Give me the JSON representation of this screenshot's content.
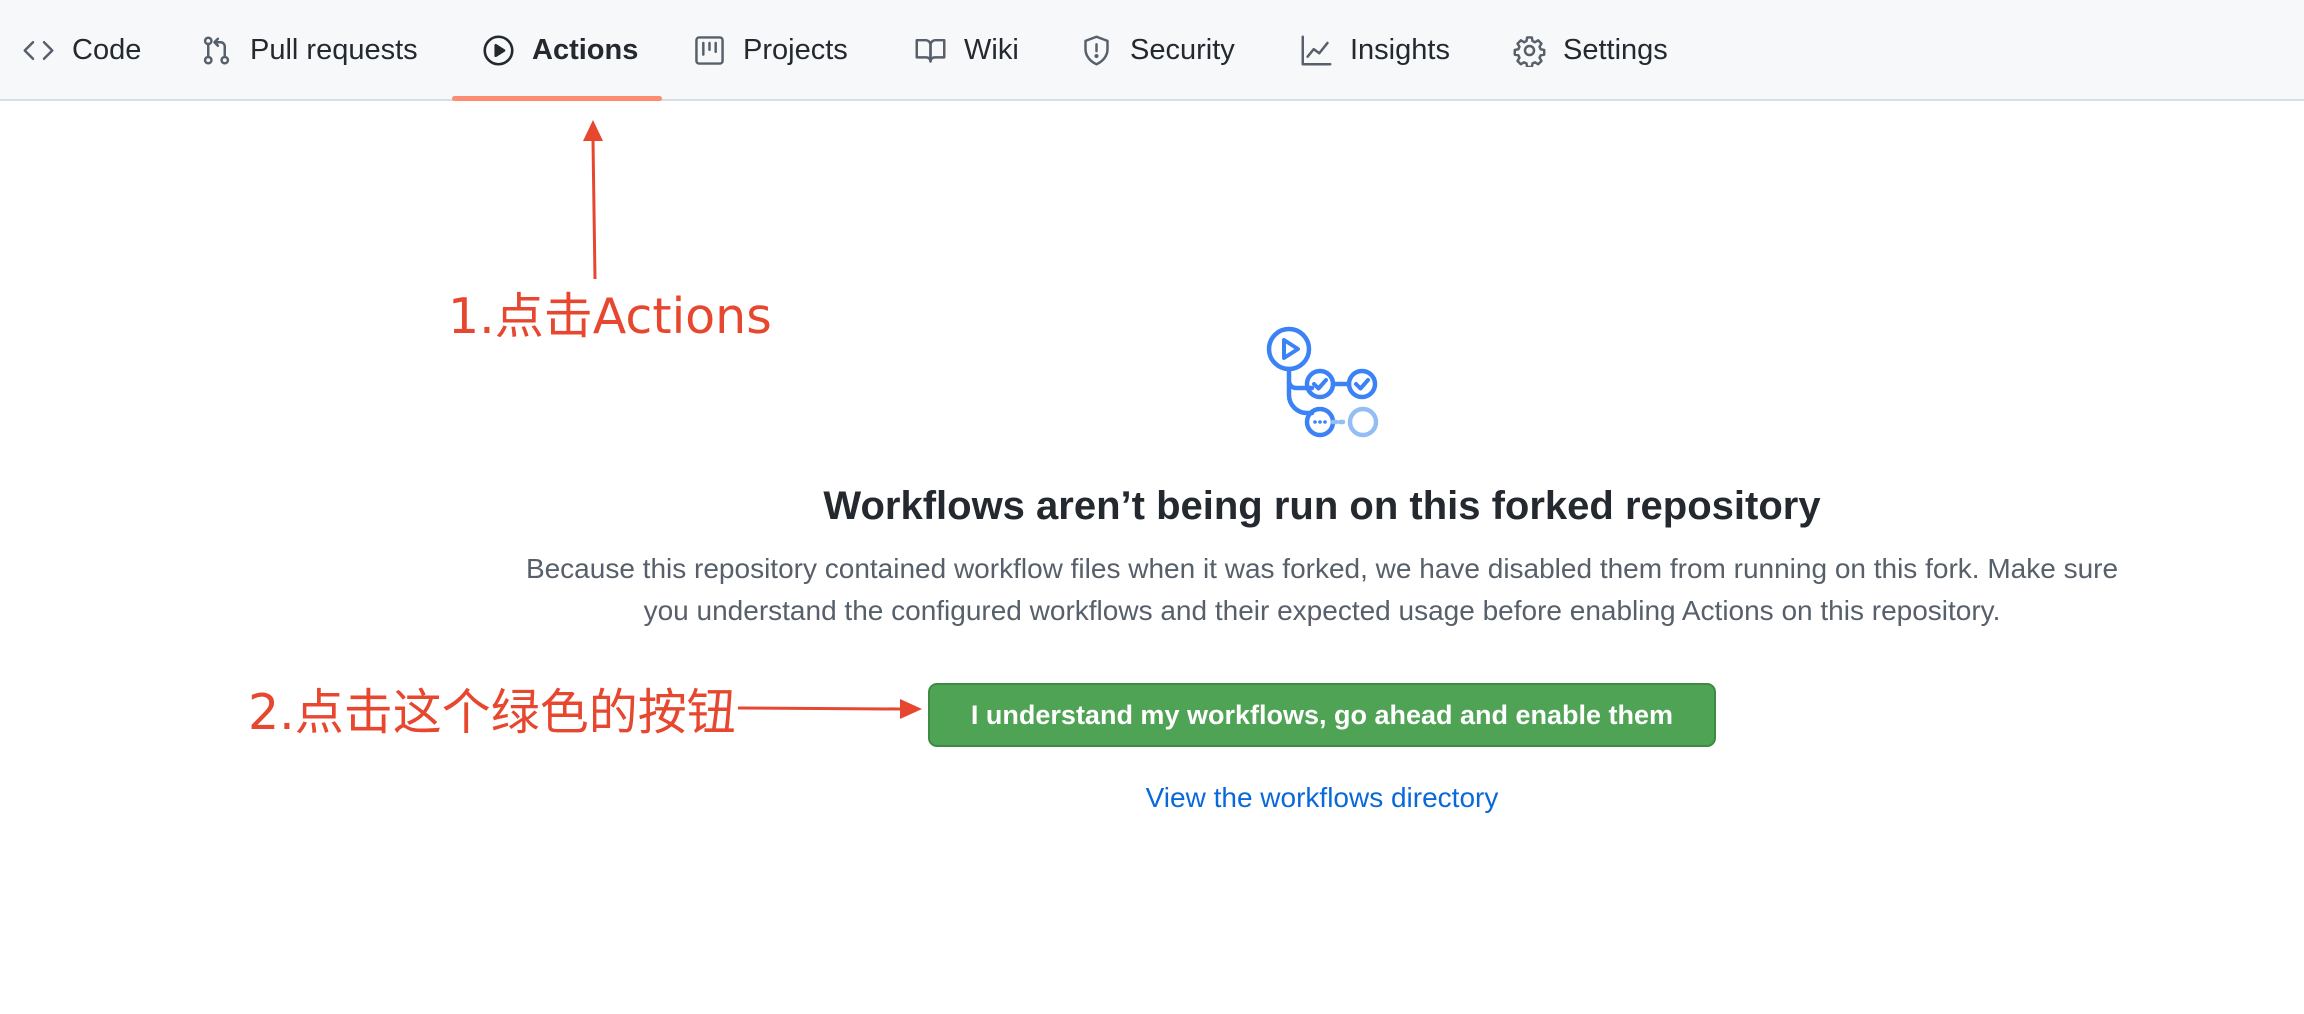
{
  "nav": {
    "tabs": [
      {
        "label": "Code",
        "icon": "code-icon"
      },
      {
        "label": "Pull requests",
        "icon": "git-pull-request-icon"
      },
      {
        "label": "Actions",
        "icon": "play-icon",
        "active": true
      },
      {
        "label": "Projects",
        "icon": "project-board-icon"
      },
      {
        "label": "Wiki",
        "icon": "book-icon"
      },
      {
        "label": "Security",
        "icon": "shield-icon"
      },
      {
        "label": "Insights",
        "icon": "graph-icon"
      },
      {
        "label": "Settings",
        "icon": "gear-icon"
      }
    ],
    "active_underline_color": "#fd8c73"
  },
  "annotations": {
    "step1": "1.点击Actions",
    "step2": "2.点击这个绿色的按钮",
    "color": "#e7472f"
  },
  "blankslate": {
    "icon": "workflow-icon",
    "title": "Workflows aren’t being run on this forked repository",
    "description": "Because this repository contained workflow files when it was forked, we have disabled them from running on this fork. Make sure you understand the configured workflows and their expected usage before enabling Actions on this repository.",
    "enable_button": "I understand my workflows, go ahead and enable them",
    "workflows_link": "View the workflows directory",
    "button_color": "#4fa354",
    "link_color": "#0969da"
  }
}
